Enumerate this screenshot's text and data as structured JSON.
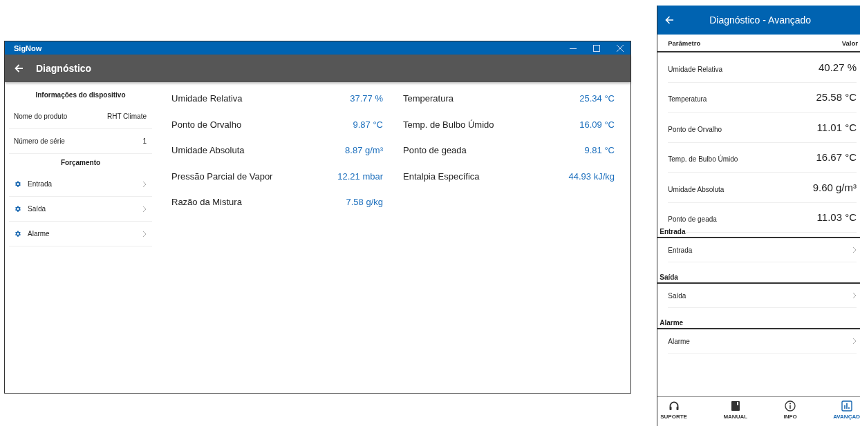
{
  "window": {
    "title": "SigNow"
  },
  "app_bar": {
    "title": "Diagnóstico"
  },
  "device_info": {
    "heading": "Informações do dispositivo",
    "rows": [
      {
        "label": "Nome do produto",
        "value": "RHT Climate"
      },
      {
        "label": "Número de série",
        "value": "1"
      }
    ]
  },
  "forcing": {
    "heading": "Forçamento",
    "items": [
      {
        "label": "Entrada"
      },
      {
        "label": "Saída"
      },
      {
        "label": "Alarme"
      }
    ]
  },
  "readings": [
    [
      {
        "label": "Umidade Relativa",
        "value": "37.77 %"
      },
      {
        "label": "Ponto de Orvalho",
        "value": "9.87 °C"
      },
      {
        "label": "Umidade Absoluta",
        "value": "8.87 g/m³"
      },
      {
        "label": "Pressão Parcial de Vapor",
        "value": "12.21 mbar"
      },
      {
        "label": "Razão da Mistura",
        "value": "7.58 g/kg"
      }
    ],
    [
      {
        "label": "Temperatura",
        "value": "25.34 °C"
      },
      {
        "label": "Temp. de Bulbo Úmido",
        "value": "16.09 °C"
      },
      {
        "label": "Ponto de geada",
        "value": "9.81 °C"
      },
      {
        "label": "Entalpia Específica",
        "value": "44.93 kJ/kg"
      }
    ]
  ],
  "phone": {
    "title": "Diagnóstico - Avançado",
    "table": {
      "columns": [
        "Parâmetro",
        "Valor"
      ],
      "rows": [
        {
          "label": "Umidade Relativa",
          "value": "40.27 %"
        },
        {
          "label": "Temperatura",
          "value": "25.58 °C"
        },
        {
          "label": "Ponto de Orvalho",
          "value": "11.01 °C"
        },
        {
          "label": "Temp. de Bulbo Úmido",
          "value": "16.67 °C"
        },
        {
          "label": "Umidade Absoluta",
          "value": "9.60 g/m³"
        },
        {
          "label": "Ponto de geada",
          "value": "11.03 °C"
        }
      ]
    },
    "sections": [
      {
        "heading": "Entrada",
        "item": "Entrada"
      },
      {
        "heading": "Saída",
        "item": "Saída"
      },
      {
        "heading": "Alarme",
        "item": "Alarme"
      }
    ],
    "nav": [
      {
        "kind": "headset",
        "label": "SUPORTE",
        "selected": false
      },
      {
        "kind": "book",
        "label": "MANUAL",
        "selected": false
      },
      {
        "kind": "info",
        "label": "INFO",
        "selected": false
      },
      {
        "kind": "chart",
        "label": "AVANÇAD",
        "selected": true
      }
    ]
  }
}
